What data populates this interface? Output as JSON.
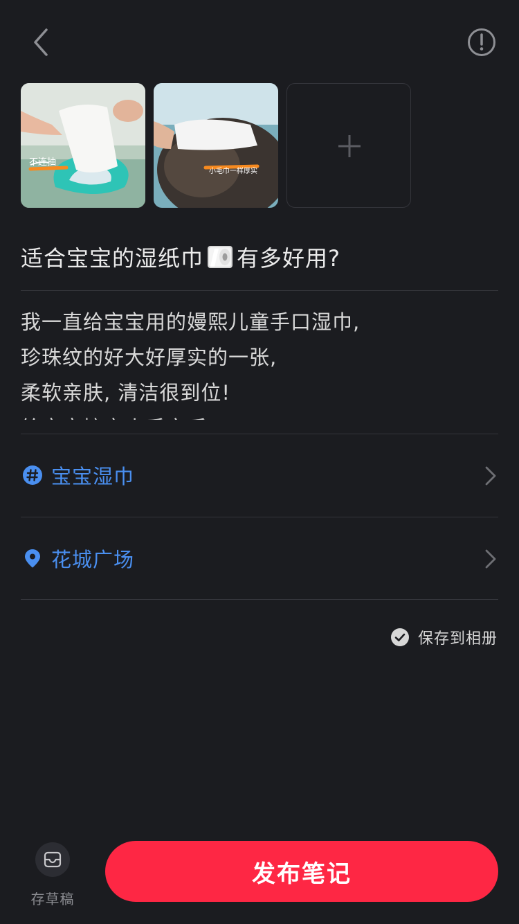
{
  "header": {
    "back_icon": "chevron-left-icon",
    "info_icon": "exclamation-circle-icon"
  },
  "images": {
    "items": [
      {
        "alt": "wet wipe pulled from pack",
        "overlay_text": "不连抽"
      },
      {
        "alt": "wipe held near baby",
        "overlay_text": "小毛巾一样厚实"
      }
    ],
    "add_icon": "plus-icon"
  },
  "note": {
    "title_before": "适合宝宝的湿纸巾",
    "title_emoji": "roll-of-paper-icon",
    "title_after": "有多好用?",
    "body_lines": [
      "我一直给宝宝用的嫚熙儿童手口湿巾,",
      "珍珠纹的好大好厚实的一张,",
      "柔软亲肤, 清洁很到位!",
      "给宝宝擦完小手之后"
    ]
  },
  "topic": {
    "icon": "hashtag-icon",
    "label": "宝宝湿巾"
  },
  "location": {
    "icon": "location-pin-icon",
    "label": "花城广场"
  },
  "save_album": {
    "label": "保存到相册",
    "checked": true
  },
  "bottom": {
    "draft_label": "存草稿",
    "draft_icon": "inbox-tray-icon",
    "publish_label": "发布笔记"
  },
  "colors": {
    "background": "#1b1c20",
    "accent_red": "#fe2744",
    "link_blue": "#4a8ff0",
    "divider": "#34353b"
  }
}
